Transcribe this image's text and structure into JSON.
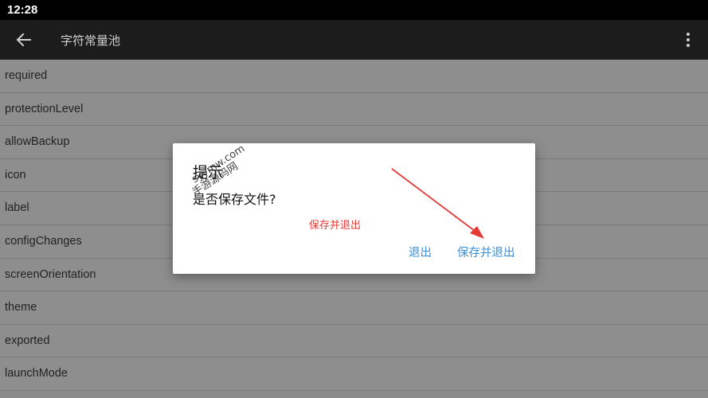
{
  "status_bar": {
    "time": "12:28"
  },
  "app_bar": {
    "title": "字符常量池",
    "back_icon": "arrow-left-icon",
    "menu_icon": "more-vertical-icon"
  },
  "list": {
    "items": [
      "required",
      "protectionLevel",
      "allowBackup",
      "icon",
      "label",
      "configChanges",
      "screenOrientation",
      "theme",
      "exported",
      "launchMode"
    ]
  },
  "dialog": {
    "title": "提示",
    "message": "是否保存文件?",
    "annotation": "保存并退出",
    "buttons": {
      "exit": "退出",
      "save_exit": "保存并退出"
    }
  },
  "watermark": {
    "line1": "手游源码网",
    "line2": "syymw.com"
  },
  "colors": {
    "accent": "#3a8fd6",
    "annotation_red": "#e53935",
    "app_bar": "#1c1c1c",
    "status_bar": "#000000"
  }
}
